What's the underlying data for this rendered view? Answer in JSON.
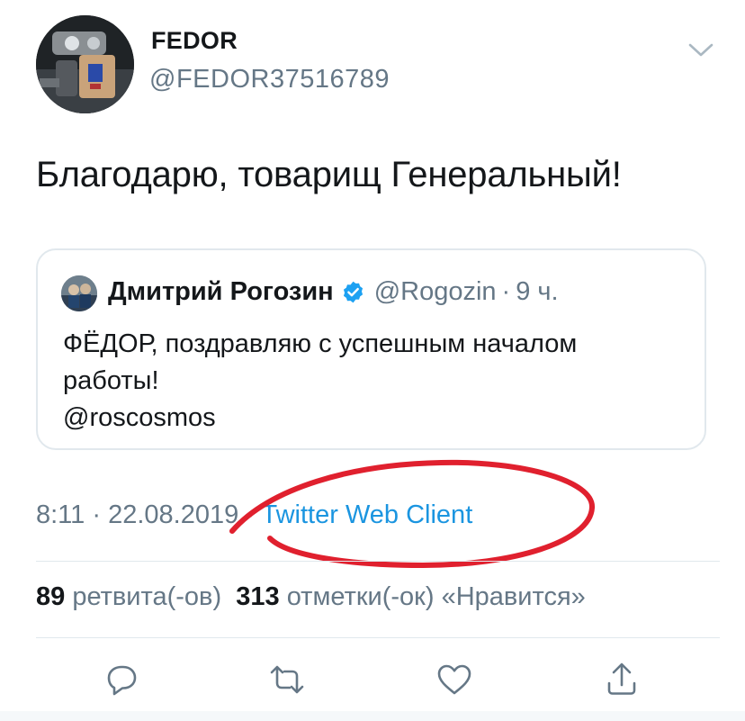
{
  "author": {
    "name": "FEDOR",
    "handle": "@FEDOR37516789"
  },
  "tweet": {
    "text": "Благодарю, товарищ Генеральный!"
  },
  "quote": {
    "name": "Дмитрий Рогозин",
    "handle": "@Rogozin",
    "separator": "·",
    "time": "9 ч.",
    "lines": [
      "ФЁДОР, поздравляю с успешным началом",
      "работы!",
      "@roscosmos"
    ]
  },
  "meta": {
    "time": "8:11",
    "sep1": " · ",
    "date": "22.08.2019",
    "sep2": " · ",
    "source": "Twitter Web Client"
  },
  "stats": {
    "retweets_count": "89",
    "retweets_label": "ретвита(-ов)",
    "likes_count": "313",
    "likes_label": "отметки(-ок) «Нравится»"
  },
  "actions": {
    "reply": "reply-icon",
    "retweet": "retweet-icon",
    "like": "heart-icon",
    "share": "share-icon"
  },
  "colors": {
    "link": "#1b95e0",
    "secondary": "#657786",
    "annotation": "#e0202e",
    "verified": "#1da1f2"
  }
}
